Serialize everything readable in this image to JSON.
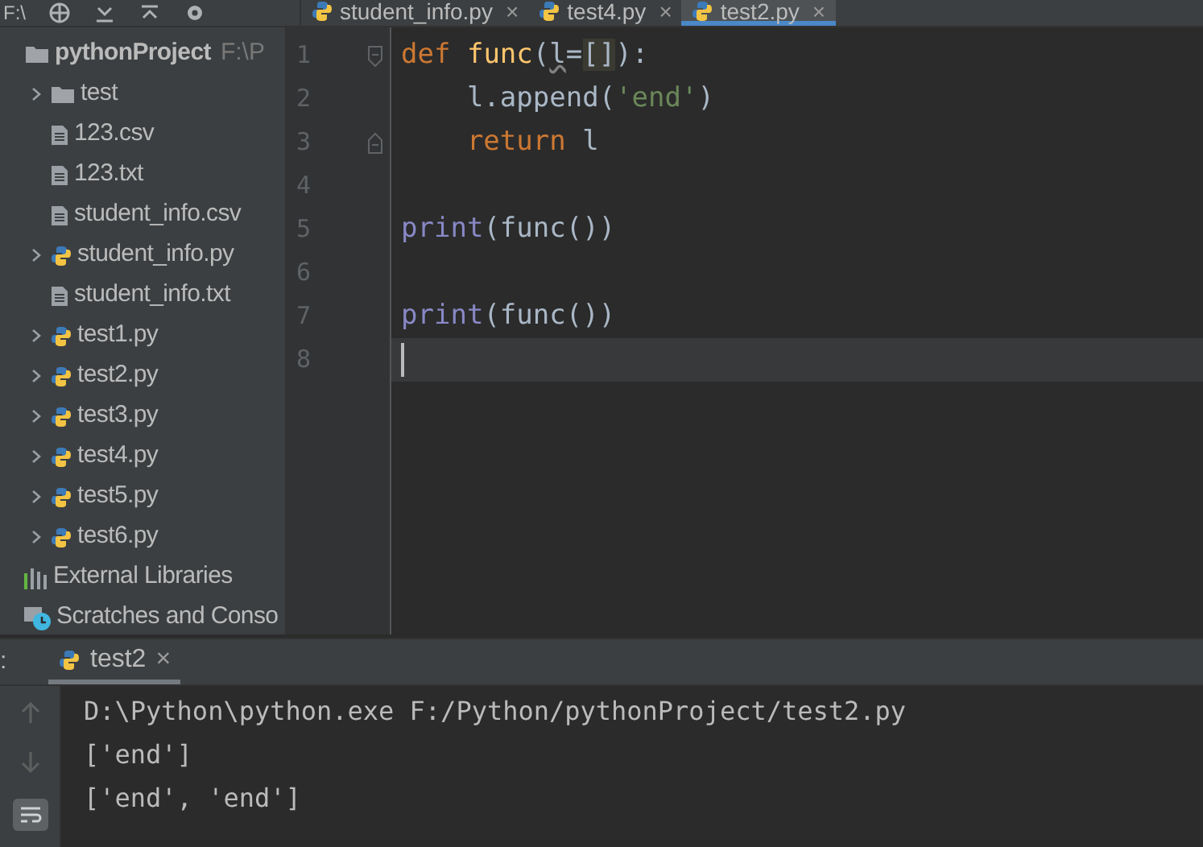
{
  "toolbar": {
    "path": "F:\\"
  },
  "tabs": [
    {
      "label": "student_info.py",
      "close": "×",
      "selected": false
    },
    {
      "label": "test4.py",
      "close": "×",
      "selected": false
    },
    {
      "label": "test2.py",
      "close": "×",
      "selected": true
    }
  ],
  "project_tree": [
    {
      "label": "pythonProject",
      "hint": "F:\\P",
      "kind": "folder",
      "children": [
        {
          "label": "test",
          "kind": "folder",
          "expandable": true
        },
        {
          "label": "123.csv",
          "kind": "file",
          "expandable": false
        },
        {
          "label": "123.txt",
          "kind": "file",
          "expandable": false
        },
        {
          "label": "student_info.csv",
          "kind": "file",
          "expandable": false
        },
        {
          "label": "student_info.py",
          "kind": "py",
          "expandable": true
        },
        {
          "label": "student_info.txt",
          "kind": "file",
          "expandable": false
        },
        {
          "label": "test1.py",
          "kind": "py",
          "expandable": true
        },
        {
          "label": "test2.py",
          "kind": "py",
          "expandable": true
        },
        {
          "label": "test3.py",
          "kind": "py",
          "expandable": true
        },
        {
          "label": "test4.py",
          "kind": "py",
          "expandable": true
        },
        {
          "label": "test5.py",
          "kind": "py",
          "expandable": true
        },
        {
          "label": "test6.py",
          "kind": "py",
          "expandable": true
        }
      ]
    },
    {
      "label": "External Libraries",
      "kind": "libraries"
    },
    {
      "label": "Scratches and Conso",
      "kind": "scratches"
    }
  ],
  "editor": {
    "lines": [
      {
        "number": "1",
        "fold_start": true,
        "tokens": [
          {
            "text": "def ",
            "kind": "keyword"
          },
          {
            "text": "func",
            "kind": "function"
          },
          {
            "text": "(",
            "kind": "plain"
          },
          {
            "text": "l",
            "kind": "param"
          },
          {
            "text": "=",
            "kind": "plain"
          },
          {
            "text": "[]",
            "kind": "match"
          },
          {
            "text": "):",
            "kind": "plain"
          }
        ]
      },
      {
        "number": "2",
        "tokens": [
          {
            "text": "    l.append(",
            "kind": "plain"
          },
          {
            "text": "'end'",
            "kind": "string"
          },
          {
            "text": ")",
            "kind": "plain"
          }
        ]
      },
      {
        "number": "3",
        "fold_end": true,
        "tokens": [
          {
            "text": "    return",
            "kind": "keyword"
          },
          {
            "text": " l",
            "kind": "plain"
          }
        ]
      },
      {
        "number": "4"
      },
      {
        "number": "5",
        "tokens": [
          {
            "text": "print",
            "kind": "builtin"
          },
          {
            "text": "(func())",
            "kind": "plain"
          }
        ]
      },
      {
        "number": "6"
      },
      {
        "number": "7",
        "tokens": [
          {
            "text": "print",
            "kind": "builtin"
          },
          {
            "text": "(func())",
            "kind": "plain"
          }
        ]
      },
      {
        "number": "8",
        "current": true
      }
    ]
  },
  "run_panel": {
    "label": ":",
    "tabs": [
      {
        "label": "test2",
        "close": "×",
        "selected": true
      }
    ],
    "output": [
      "D:\\Python\\python.exe F:/Python/pythonProject/test2.py",
      "['end']",
      "['end', 'end']"
    ]
  }
}
